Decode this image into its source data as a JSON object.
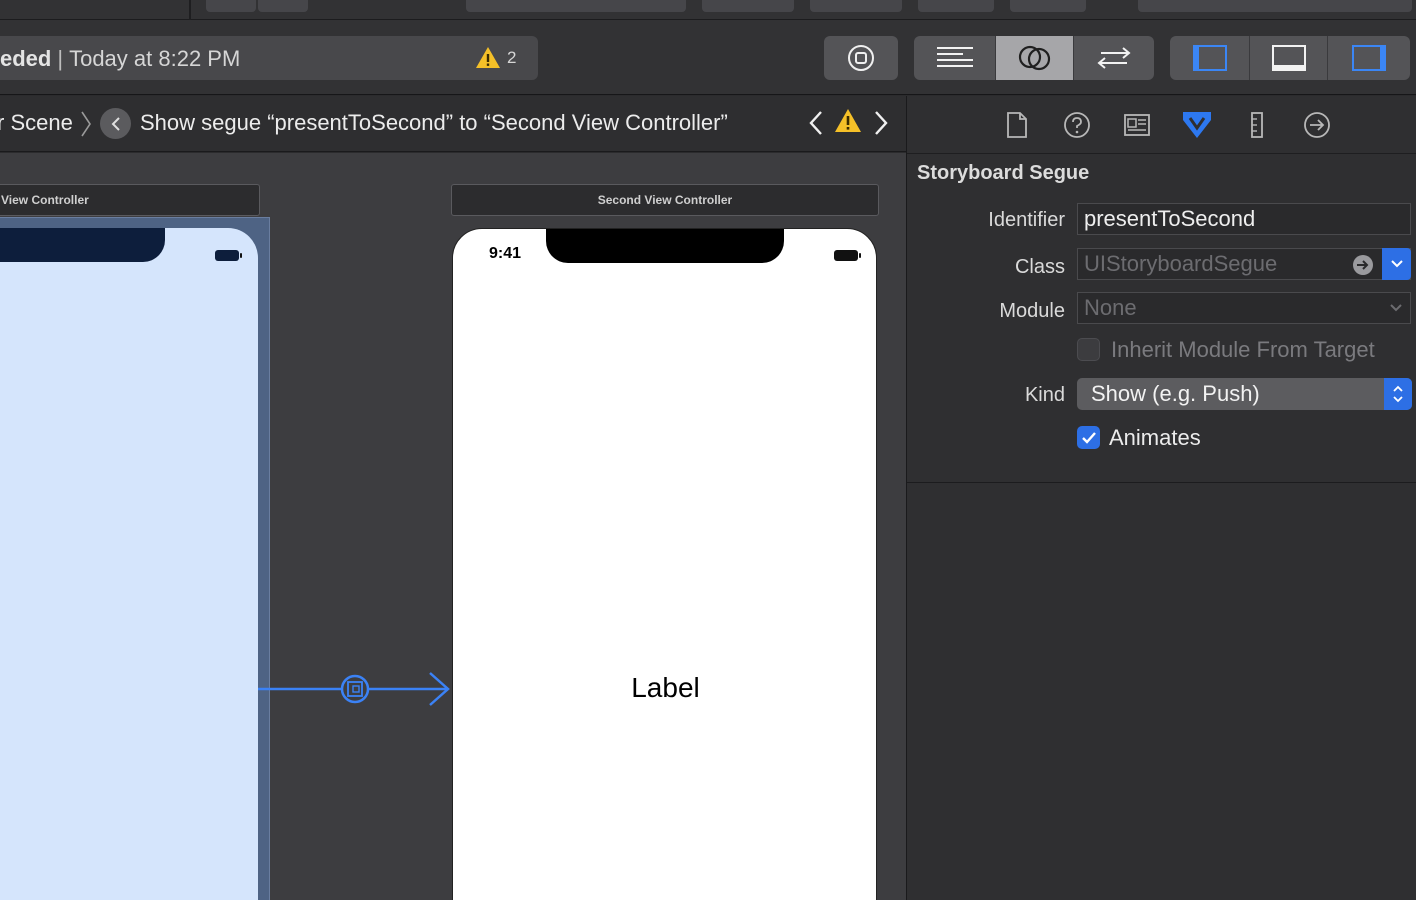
{
  "toolbar": {
    "status_prefix": "eded",
    "status_separator": "|",
    "status_time": "Today at 8:22 PM",
    "warning_count": "2"
  },
  "jumpbar": {
    "scene_crumb": "r Scene",
    "segue_crumb": "Show segue “presentToSecond” to “Second View Controller”"
  },
  "canvas": {
    "first_scene_title": "View Controller",
    "second_scene_title": "Second View Controller",
    "status_time": "9:41",
    "label_text": "Label"
  },
  "inspector": {
    "section_title": "Storyboard Segue",
    "identifier_label": "Identifier",
    "identifier_value": "presentToSecond",
    "class_label": "Class",
    "class_placeholder": "UIStoryboardSegue",
    "module_label": "Module",
    "module_placeholder": "None",
    "inherit_label": "Inherit Module From Target",
    "inherit_checked": false,
    "kind_label": "Kind",
    "kind_value": "Show (e.g. Push)",
    "animates_label": "Animates",
    "animates_checked": true
  },
  "colors": {
    "accent_blue": "#2d6fe5",
    "warning_yellow": "#f5c028",
    "segue_blue": "#3b82f6",
    "scene_background": "#d5e5fc"
  }
}
